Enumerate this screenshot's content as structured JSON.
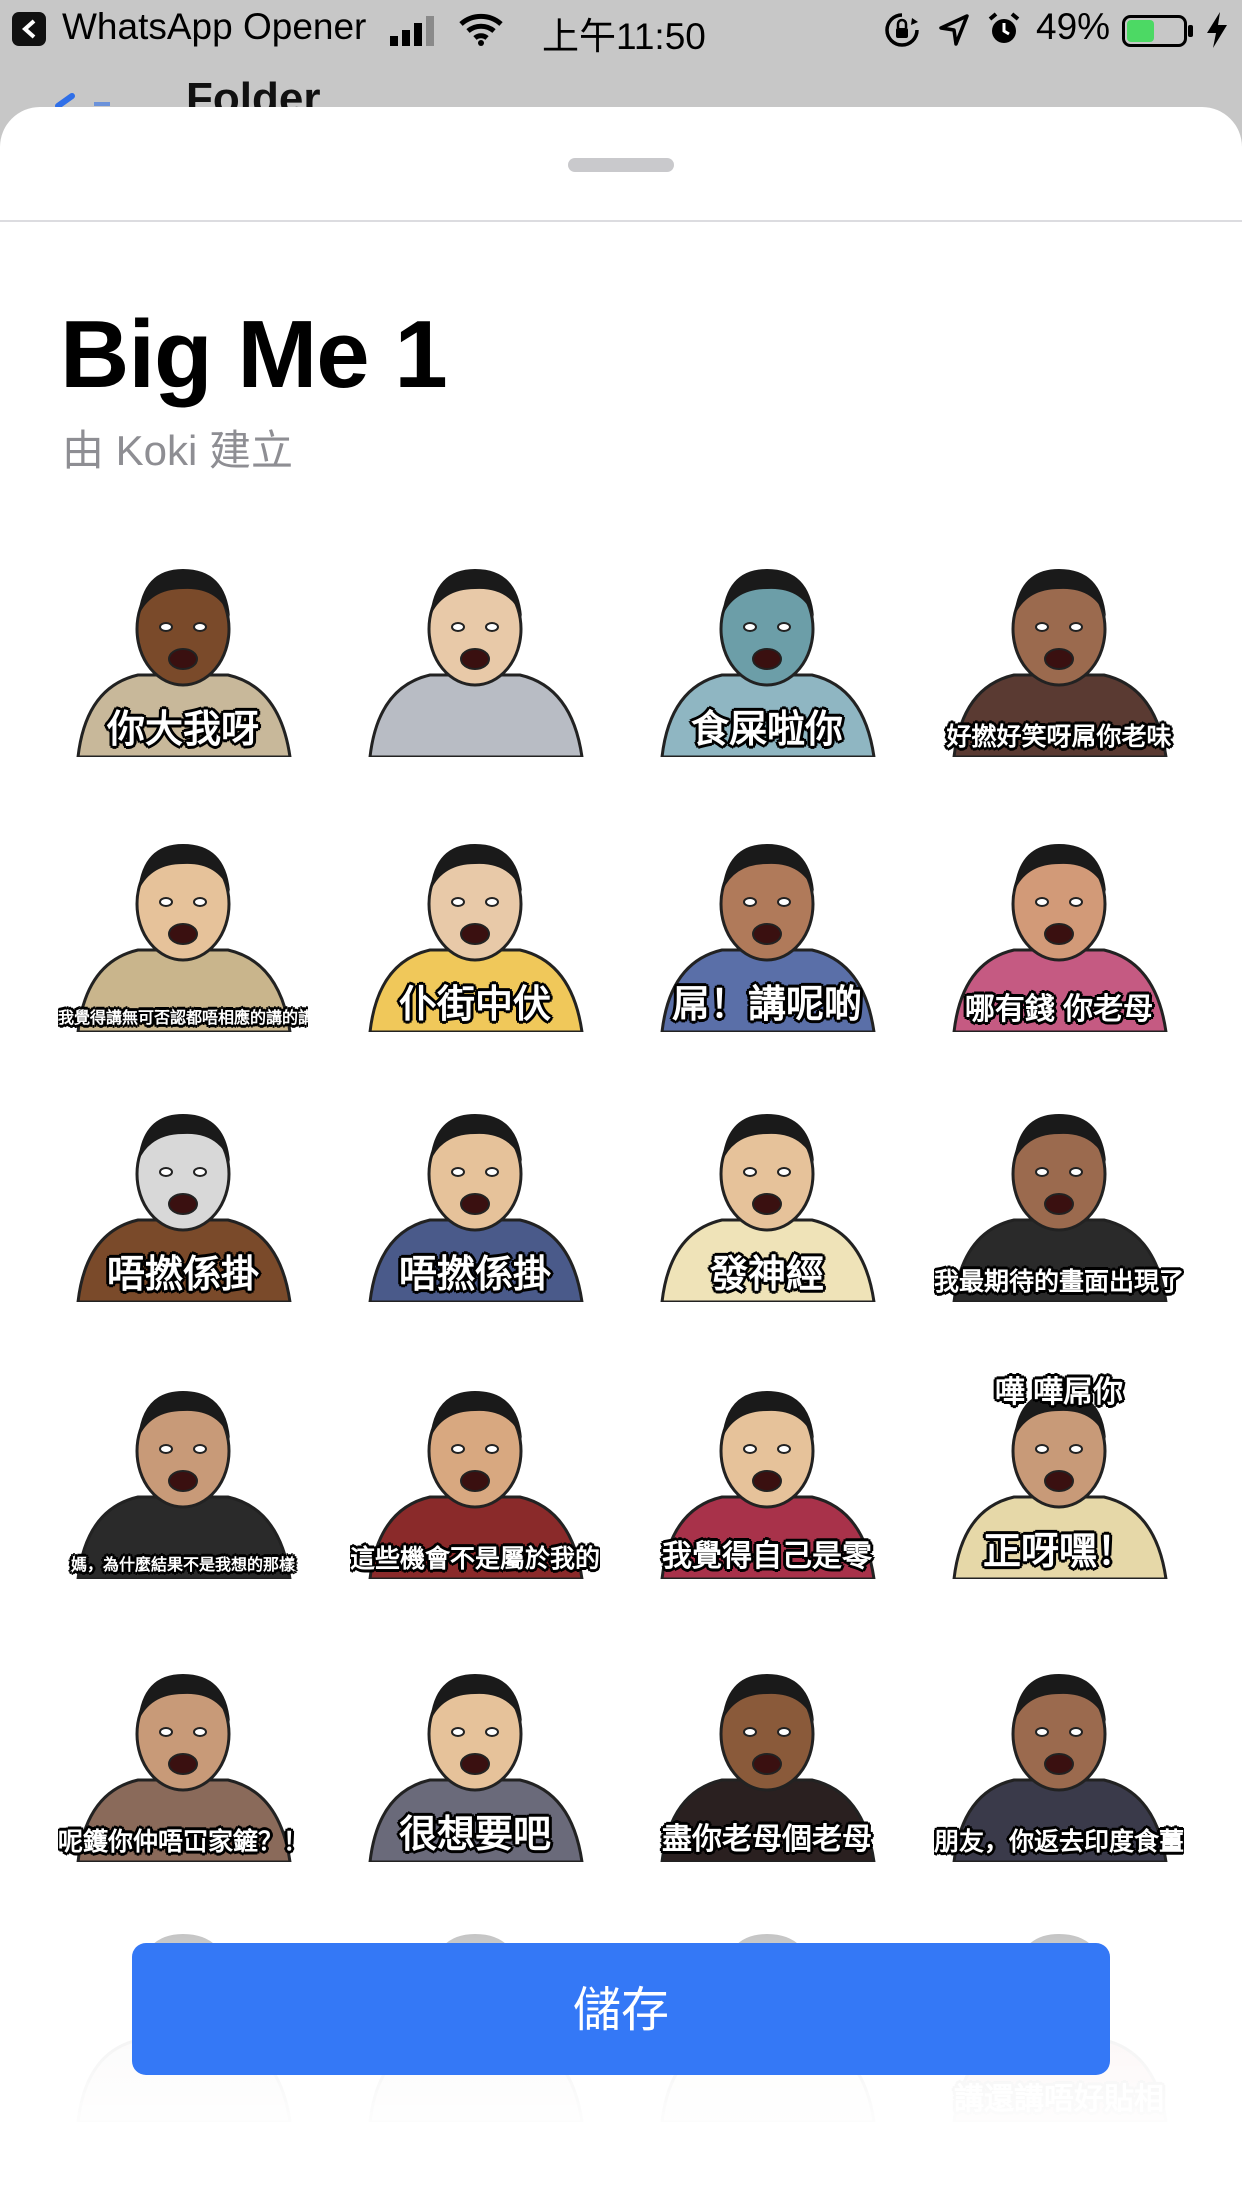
{
  "status_bar": {
    "app_name": "WhatsApp Opener",
    "time": "上午11:50",
    "battery_percent": "49%",
    "battery_level": 0.49
  },
  "nav": {
    "title": "Folder"
  },
  "sheet": {
    "title": "Big Me 1",
    "author": "由 Koki 建立",
    "save_label": "儲存"
  },
  "stickers": [
    {
      "caption": "你大我呀",
      "skin": "#7a4a2a",
      "shirt": "#c8b89a"
    },
    {
      "caption": "",
      "skin": "#e8c9a8",
      "shirt": "#b8bcc4"
    },
    {
      "caption": "食屎啦你",
      "skin": "#6c9ea8",
      "shirt": "#8fb6c2"
    },
    {
      "caption": "好撚好笑呀屌你老味",
      "skin": "#9b6a4e",
      "shirt": "#5a3a32"
    },
    {
      "caption": "我覺得講無可否認都唔相應的講的講呀好",
      "skin": "#e6c29a",
      "shirt": "#c9b58c"
    },
    {
      "caption": "仆街中伏",
      "skin": "#e8c9a8",
      "shirt": "#f0c85a"
    },
    {
      "caption": "屌！講呢啲",
      "skin": "#b07a5a",
      "shirt": "#5a6fa8"
    },
    {
      "caption": "哪有錢 你老母",
      "skin": "#d29a78",
      "shirt": "#c55a82"
    },
    {
      "caption": "唔撚係掛",
      "skin": "#d8d8d8",
      "shirt": "#7a4a2a"
    },
    {
      "caption": "唔撚係掛",
      "skin": "#e6c29a",
      "shirt": "#4a5a8a"
    },
    {
      "caption": "發神經",
      "skin": "#e6c29a",
      "shirt": "#efe3b8"
    },
    {
      "caption": "我最期待的畫面出現了",
      "skin": "#9b6a4e",
      "shirt": "#2a2a2a"
    },
    {
      "caption": "媽，為什麼結果不是我想的那樣",
      "skin": "#c89a78",
      "shirt": "#2a2a2a"
    },
    {
      "caption": "這些機會不是屬於我的",
      "skin": "#d8a880",
      "shirt": "#8a2a2a"
    },
    {
      "caption": "我覺得自己是零",
      "skin": "#e6c29a",
      "shirt": "#a8324a"
    },
    {
      "caption": "正呀嘿！",
      "caption_top": "嘩 嘩屌你",
      "skin": "#c89a78",
      "shirt": "#e6d8a8"
    },
    {
      "caption": "呢鑊你仲唔冚家鏟？！",
      "skin": "#c89a78",
      "shirt": "#8a6a5a"
    },
    {
      "caption": "很想要吧",
      "skin": "#e6c29a",
      "shirt": "#6a6a7a"
    },
    {
      "caption": "盡你老母個老母",
      "skin": "#8a5a3a",
      "shirt": "#2a2020"
    },
    {
      "caption": "朋友，你返去印度食薑啦",
      "skin": "#9b6a4e",
      "shirt": "#3a3a4a"
    },
    {
      "caption": "",
      "skin": "#d8c0b0",
      "shirt": "#c0b0b0"
    },
    {
      "caption": "",
      "skin": "#d8c0b0",
      "shirt": "#c0b0b0"
    },
    {
      "caption": "",
      "skin": "#d8c0b0",
      "shirt": "#e0d8c8"
    },
    {
      "caption": "講還講唔好貼相",
      "skin": "#d8a8a0",
      "shirt": "#c86a6a"
    }
  ]
}
